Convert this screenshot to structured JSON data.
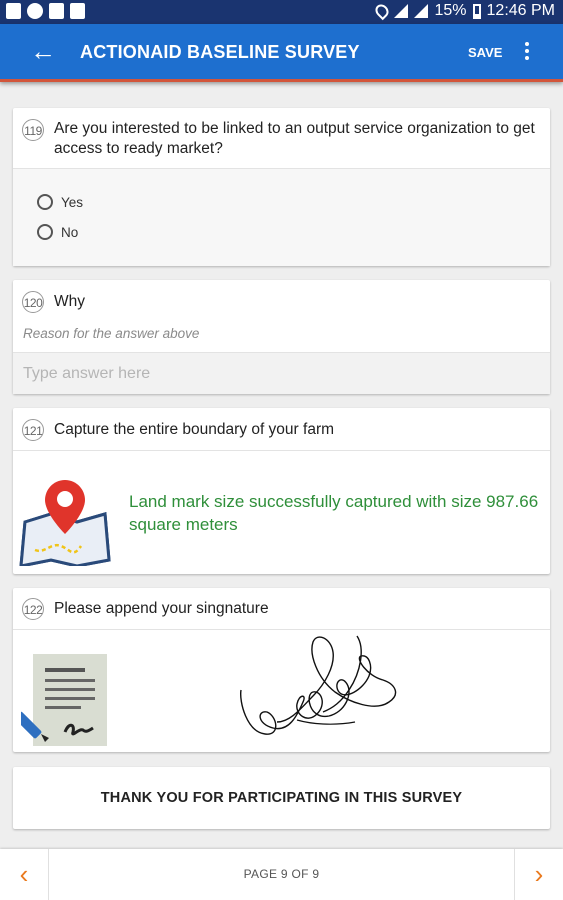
{
  "status_bar": {
    "battery": "15%",
    "time": "12:46 PM"
  },
  "app_bar": {
    "title": "ACTIONAID BASELINE SURVEY",
    "save_label": "SAVE",
    "back_icon": "back-arrow-icon",
    "more_icon": "more-vert-icon"
  },
  "questions": [
    {
      "number": "119",
      "text": "Are you interested to be linked to an output service organization to get access to ready market?",
      "options": [
        "Yes",
        "No"
      ]
    },
    {
      "number": "120",
      "text": "Why",
      "hint": "Reason for the answer above",
      "placeholder": "Type answer here"
    },
    {
      "number": "121",
      "text": "Capture the entire boundary of your farm",
      "status": "Land mark size successfully captured with size 987.66 square meters"
    },
    {
      "number": "122",
      "text": "Please append your singnature"
    }
  ],
  "thanks": "THANK YOU FOR PARTICIPATING IN THIS SURVEY",
  "pagination": {
    "label": "PAGE 9 OF 9"
  },
  "colors": {
    "status_bar": "#1a3470",
    "app_bar": "#1e6fcf",
    "success_text": "#2f8f3a",
    "nav_arrow": "#ea7a1e"
  }
}
